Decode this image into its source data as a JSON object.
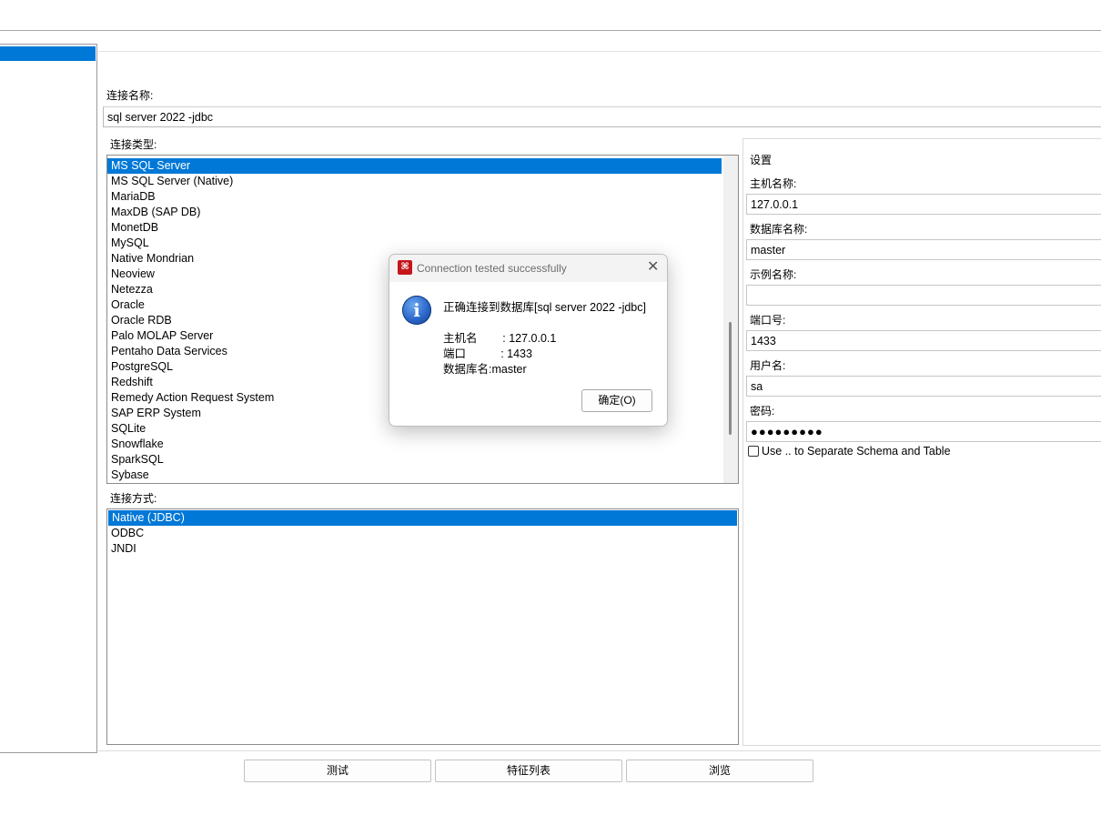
{
  "form": {
    "conn_name_label": "连接名称:",
    "conn_name_value": "sql server 2022 -jdbc",
    "conn_type_label": "连接类型:",
    "conn_types": [
      "MS SQL Server",
      "MS SQL Server (Native)",
      "MariaDB",
      "MaxDB (SAP DB)",
      "MonetDB",
      "MySQL",
      "Native Mondrian",
      "Neoview",
      "Netezza",
      "Oracle",
      "Oracle RDB",
      "Palo MOLAP Server",
      "Pentaho Data Services",
      "PostgreSQL",
      "Redshift",
      "Remedy Action Request System",
      "SAP ERP System",
      "SQLite",
      "Snowflake",
      "SparkSQL",
      "Sybase"
    ],
    "conn_type_selected": "MS SQL Server",
    "method_label": "连接方式:",
    "methods": [
      "Native (JDBC)",
      "ODBC",
      "JNDI"
    ],
    "method_selected": "Native (JDBC)"
  },
  "settings": {
    "title": "设置",
    "host_label": "主机名称:",
    "host_value": "127.0.0.1",
    "db_label": "数据库名称:",
    "db_value": "master",
    "instance_label": "示例名称:",
    "instance_value": "",
    "port_label": "端口号:",
    "port_value": "1433",
    "user_label": "用户名:",
    "user_value": "sa",
    "password_label": "密码:",
    "password_value": "●●●●●●●●●",
    "separate_label": "Use .. to Separate Schema and Table",
    "separate_checked": false
  },
  "buttons": {
    "test": "测试",
    "features": "特征列表",
    "browse": "浏览"
  },
  "dialog": {
    "title": "Connection tested successfully",
    "close": "✕",
    "logo": "⌘",
    "icon": "i",
    "message": "正确连接到数据库[sql server 2022 -jdbc]",
    "host_line": "主机名        : 127.0.0.1",
    "port_line": "端口           : 1433",
    "db_line": "数据库名:master",
    "ok_label": "确定(O)"
  },
  "colors": {
    "selection": "#0078d7",
    "logo_red": "#c4161c"
  }
}
